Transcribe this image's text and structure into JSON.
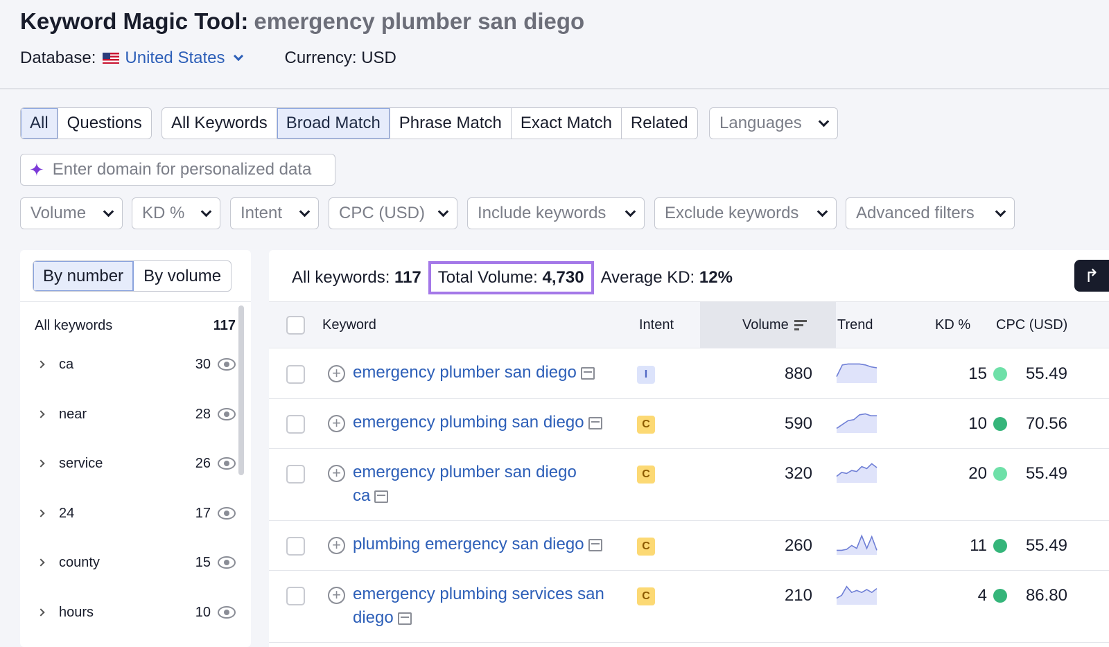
{
  "header": {
    "title": "Keyword Magic Tool:",
    "query": "emergency plumber san diego",
    "database_label": "Database:",
    "database_value": "United States",
    "currency": "Currency: USD"
  },
  "tabs_left": [
    "All",
    "Questions"
  ],
  "tabs_match": [
    "All Keywords",
    "Broad Match",
    "Phrase Match",
    "Exact Match",
    "Related"
  ],
  "languages": "Languages",
  "domain_input": {
    "placeholder": "Enter domain for personalized data"
  },
  "filters": [
    "Volume",
    "KD %",
    "Intent",
    "CPC (USD)",
    "Include keywords",
    "Exclude keywords",
    "Advanced filters"
  ],
  "sidebar": {
    "toggle": [
      "By number",
      "By volume"
    ],
    "all_label": "All keywords",
    "all_count": "117",
    "groups": [
      {
        "name": "ca",
        "count": "30"
      },
      {
        "name": "near",
        "count": "28"
      },
      {
        "name": "service",
        "count": "26"
      },
      {
        "name": "24",
        "count": "17"
      },
      {
        "name": "county",
        "count": "15"
      },
      {
        "name": "hours",
        "count": "10"
      }
    ]
  },
  "summary": {
    "all_label": "All keywords:",
    "all_value": "117",
    "volume_label": "Total Volume:",
    "volume_value": "4,730",
    "kd_label": "Average KD:",
    "kd_value": "12%"
  },
  "table": {
    "headers": {
      "keyword": "Keyword",
      "intent": "Intent",
      "volume": "Volume",
      "trend": "Trend",
      "kd": "KD %",
      "cpc": "CPC (USD)"
    },
    "rows": [
      {
        "keyword_line1": "emergency plumber san diego",
        "keyword_line2": "",
        "intent": "I",
        "volume": "880",
        "kd": "15",
        "kd_color": "#6ee0a8",
        "cpc": "55.49",
        "trend": [
          0.3,
          0.9,
          0.95,
          0.95,
          0.95,
          0.9,
          0.8,
          0.75
        ]
      },
      {
        "keyword_line1": "emergency plumbing san diego",
        "keyword_line2": "",
        "intent": "C",
        "volume": "590",
        "kd": "10",
        "kd_color": "#35b57a",
        "cpc": "70.56",
        "trend": [
          0.2,
          0.4,
          0.6,
          0.65,
          0.9,
          0.95,
          0.85,
          0.85
        ]
      },
      {
        "keyword_line1": "emergency plumber san diego",
        "keyword_line2": "ca",
        "intent": "C",
        "volume": "320",
        "kd": "20",
        "kd_color": "#6ee0a8",
        "cpc": "55.49",
        "trend": [
          0.3,
          0.5,
          0.45,
          0.6,
          0.55,
          0.8,
          0.7,
          0.95,
          0.75
        ]
      },
      {
        "keyword_line1": "plumbing emergency san diego",
        "keyword_line2": "",
        "intent": "C",
        "volume": "260",
        "kd": "11",
        "kd_color": "#35b57a",
        "cpc": "55.49",
        "trend": [
          0.2,
          0.2,
          0.25,
          0.45,
          0.3,
          0.95,
          0.3,
          0.9,
          0.2
        ]
      },
      {
        "keyword_line1": "emergency plumbing services san",
        "keyword_line2": "diego",
        "intent": "C",
        "volume": "210",
        "kd": "4",
        "kd_color": "#35b57a",
        "cpc": "86.80",
        "trend": [
          0.3,
          0.45,
          0.9,
          0.6,
          0.7,
          0.6,
          0.75,
          0.6,
          0.8
        ]
      }
    ]
  }
}
